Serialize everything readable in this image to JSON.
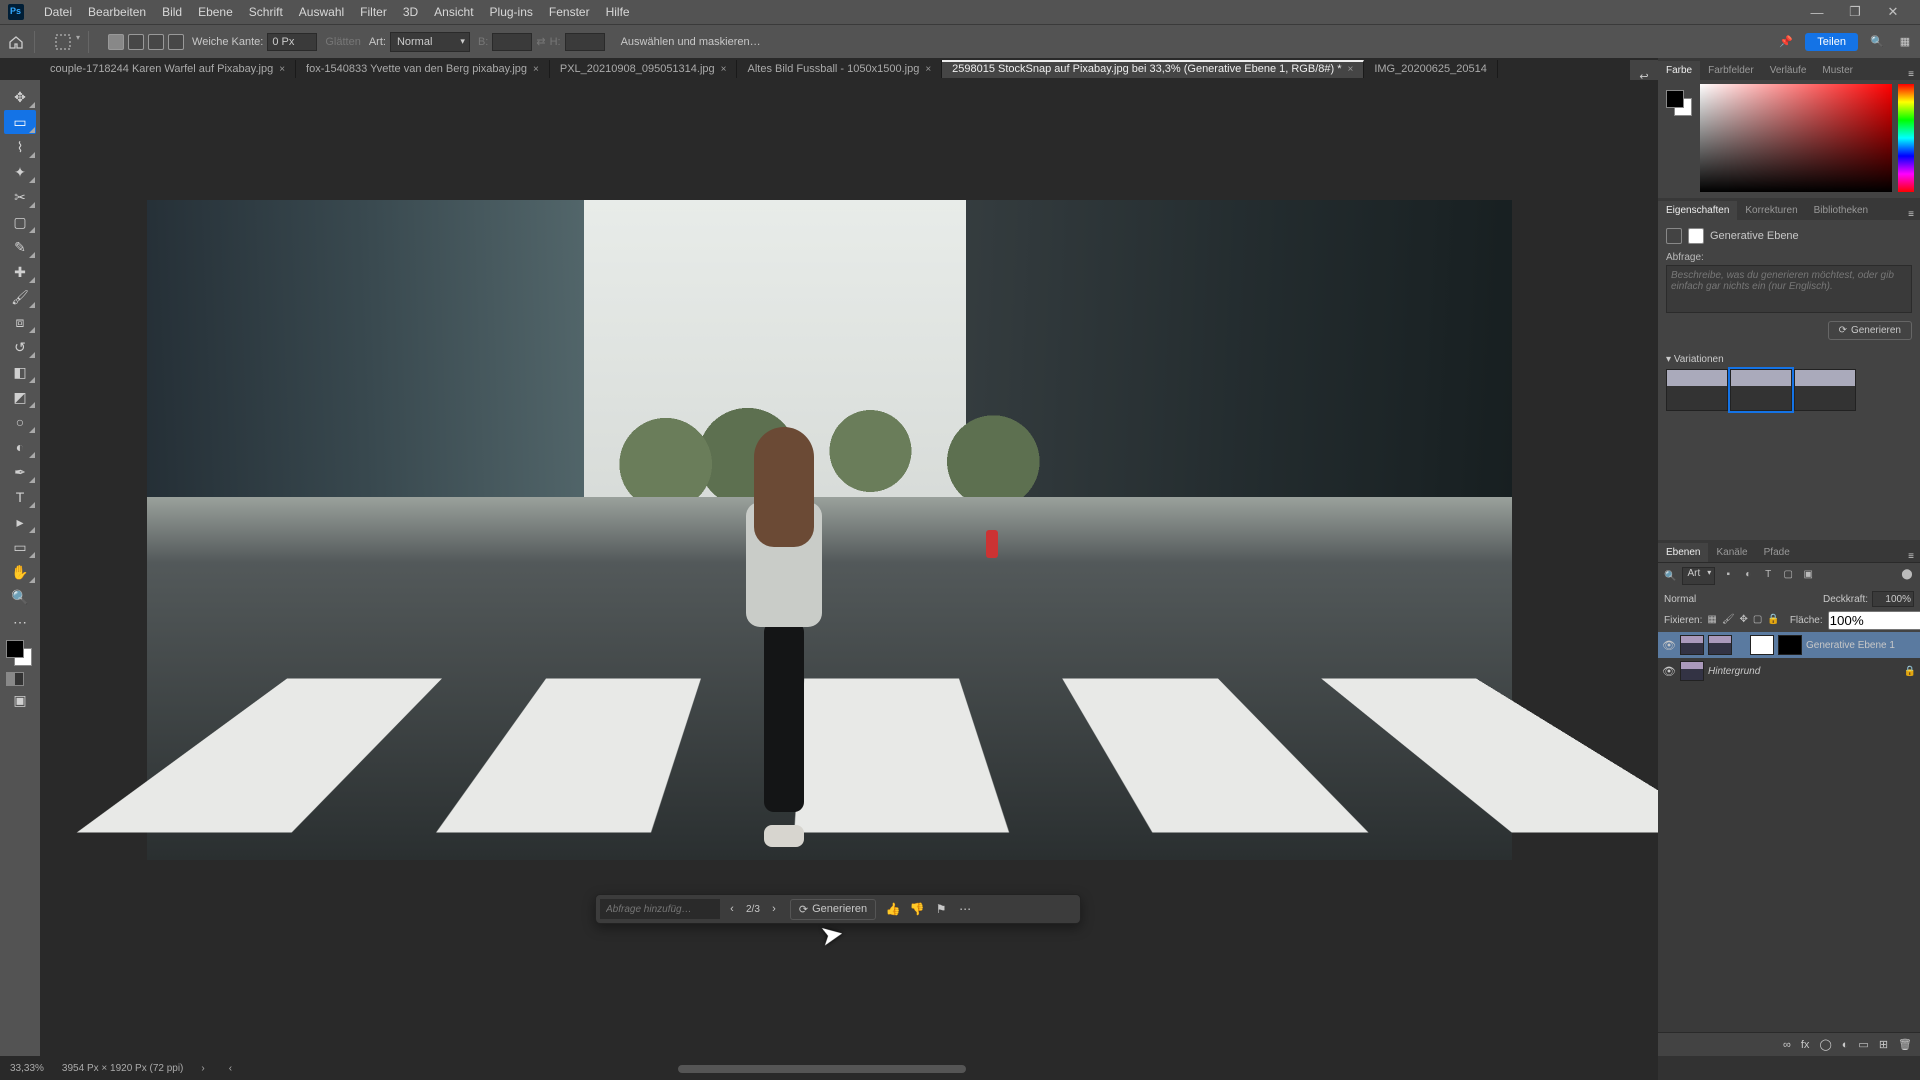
{
  "menubar": {
    "items": [
      "Datei",
      "Bearbeiten",
      "Bild",
      "Ebene",
      "Schrift",
      "Auswahl",
      "Filter",
      "3D",
      "Ansicht",
      "Plug-ins",
      "Fenster",
      "Hilfe"
    ]
  },
  "optbar": {
    "feather_label": "Weiche Kante:",
    "feather_value": "0 Px",
    "antialias": "Glätten",
    "style_label": "Art:",
    "style_value": "Normal",
    "width_label": "B:",
    "width_value": "",
    "height_label": "H:",
    "height_value": "",
    "mask_btn": "Auswählen und maskieren…",
    "share": "Teilen"
  },
  "tabs": [
    {
      "label": "couple-1718244 Karen Warfel auf Pixabay.jpg",
      "active": false
    },
    {
      "label": "fox-1540833 Yvette van den Berg pixabay.jpg",
      "active": false
    },
    {
      "label": "PXL_20210908_095051314.jpg",
      "active": false
    },
    {
      "label": "Altes Bild Fussball - 1050x1500.jpg",
      "active": false
    },
    {
      "label": "2598015 StockSnap auf Pixabay.jpg bei 33,3% (Generative Ebene 1, RGB/8#) *",
      "active": true
    },
    {
      "label": "IMG_20200625_20514",
      "active": false
    }
  ],
  "ctxbar": {
    "prompt_placeholder": "Abfrage hinzufüg…",
    "counter": "2/3",
    "generate": "Generieren"
  },
  "panels": {
    "color_tabs": [
      "Farbe",
      "Farbfelder",
      "Verläufe",
      "Muster"
    ],
    "prop_tabs": [
      "Eigenschaften",
      "Korrekturen",
      "Bibliotheken"
    ],
    "layer_tabs": [
      "Ebenen",
      "Kanäle",
      "Pfade"
    ]
  },
  "properties": {
    "title": "Generative Ebene",
    "prompt_label": "Abfrage:",
    "prompt_placeholder": "Beschreibe, was du generieren möchtest, oder gib einfach gar nichts ein (nur Englisch).",
    "generate": "Generieren",
    "variations_label": "Variationen"
  },
  "layers": {
    "filter_kind": "Art",
    "blend_mode": "Normal",
    "opacity_label": "Deckkraft:",
    "opacity_value": "100%",
    "lock_label": "Fixieren:",
    "fill_label": "Fläche:",
    "fill_value": "100%",
    "rows": [
      {
        "name": "Generative Ebene 1",
        "locked": false,
        "selected": true,
        "kind": "gen"
      },
      {
        "name": "Hintergrund",
        "locked": true,
        "selected": false,
        "kind": "bg"
      }
    ]
  },
  "status": {
    "zoom": "33,33%",
    "doc": "3954 Px × 1920 Px (72 ppi)"
  },
  "colors": {
    "accent": "#1473e6"
  }
}
